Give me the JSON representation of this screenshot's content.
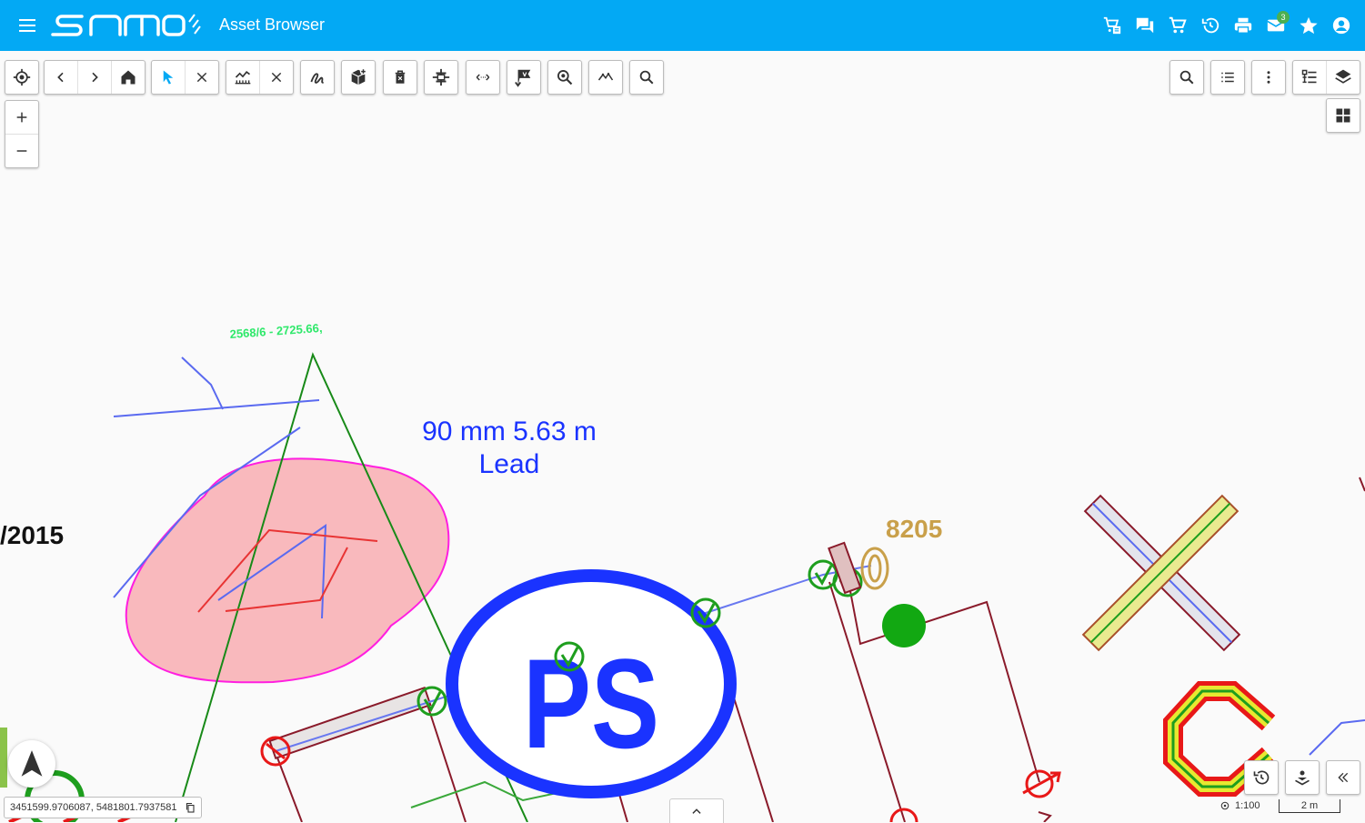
{
  "app": {
    "title": "Asset Browser",
    "accent": "#03a9f4",
    "mail_badge": "3"
  },
  "header_icons": [
    "cart-list-icon",
    "chat-icon",
    "cart-icon",
    "history-icon",
    "print-icon",
    "mail-icon",
    "star-icon",
    "account-icon"
  ],
  "map_labels": {
    "parcel": "2568/6 - 2725.66,",
    "pipe_line1": "90 mm 5.63 m",
    "pipe_line2": "Lead",
    "date_fragment": "/2015",
    "asset_id": "8205",
    "station": "PS"
  },
  "status": {
    "coordinates": "3451599.9706087, 5481801.7937581",
    "scale": "1:100",
    "scalebar": "2 m"
  },
  "colors": {
    "pipe_blue": "#1a33ff",
    "parcel_green": "#2ee86a",
    "asset_gold": "#c9a04a",
    "boundary_magenta": "#ff1ee0",
    "fill_pink": "#f9b9bd"
  }
}
